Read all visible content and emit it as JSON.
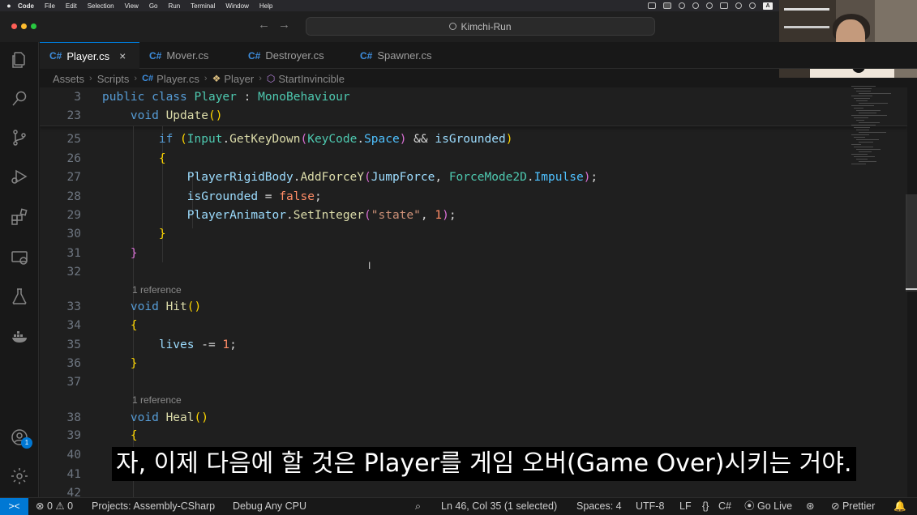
{
  "menubar": {
    "apple": "",
    "items": [
      "Code",
      "File",
      "Edit",
      "Selection",
      "View",
      "Go",
      "Run",
      "Terminal",
      "Window",
      "Help"
    ],
    "tray_letter": "A"
  },
  "titlebar": {
    "search_text": "Kimchi-Run",
    "back": "←",
    "forward": "→"
  },
  "tabs": [
    {
      "label": "Player.cs",
      "icon": "C#",
      "active": true,
      "close": "×"
    },
    {
      "label": "Mover.cs",
      "icon": "C#"
    },
    {
      "label": "Destroyer.cs",
      "icon": "C#"
    },
    {
      "label": "Spawner.cs",
      "icon": "C#"
    }
  ],
  "breadcrumb": [
    "Assets",
    "Scripts",
    "Player.cs",
    "Player",
    "StartInvincible"
  ],
  "editor": {
    "lines": [
      {
        "n": "3",
        "tokens": [
          [
            "k",
            "public "
          ],
          [
            "k",
            "class "
          ],
          [
            "c",
            "Player"
          ],
          [
            "p",
            " : "
          ],
          [
            "c",
            "MonoBehaviour"
          ]
        ]
      },
      {
        "n": "23",
        "tokens": [
          [
            "p",
            "    "
          ],
          [
            "k",
            "void "
          ],
          [
            "f",
            "Update"
          ],
          [
            "br",
            "()"
          ]
        ]
      },
      {
        "n": "25",
        "tokens": [
          [
            "p",
            "        "
          ],
          [
            "k",
            "if "
          ],
          [
            "br",
            "("
          ],
          [
            "c",
            "Input"
          ],
          [
            "p",
            "."
          ],
          [
            "f",
            "GetKeyDown"
          ],
          [
            "br2",
            "("
          ],
          [
            "c",
            "KeyCode"
          ],
          [
            "p",
            "."
          ],
          [
            "m",
            "Space"
          ],
          [
            "br2",
            ")"
          ],
          [
            "p",
            " && "
          ],
          [
            "v",
            "isGrounded"
          ],
          [
            "br",
            ")"
          ]
        ]
      },
      {
        "n": "26",
        "tokens": [
          [
            "p",
            "        "
          ],
          [
            "br",
            "{"
          ]
        ]
      },
      {
        "n": "27",
        "tokens": [
          [
            "p",
            "            "
          ],
          [
            "v",
            "PlayerRigidBody"
          ],
          [
            "p",
            "."
          ],
          [
            "f",
            "AddForceY"
          ],
          [
            "br2",
            "("
          ],
          [
            "v",
            "JumpForce"
          ],
          [
            "p",
            ", "
          ],
          [
            "c",
            "ForceMode2D"
          ],
          [
            "p",
            "."
          ],
          [
            "m",
            "Impulse"
          ],
          [
            "br2",
            ")"
          ],
          [
            "p",
            ";"
          ]
        ]
      },
      {
        "n": "28",
        "tokens": [
          [
            "p",
            "            "
          ],
          [
            "v",
            "isGrounded"
          ],
          [
            "p",
            " = "
          ],
          [
            "fl",
            "false"
          ],
          [
            "p",
            ";"
          ]
        ]
      },
      {
        "n": "29",
        "tokens": [
          [
            "p",
            "            "
          ],
          [
            "v",
            "PlayerAnimator"
          ],
          [
            "p",
            "."
          ],
          [
            "f",
            "SetInteger"
          ],
          [
            "br2",
            "("
          ],
          [
            "s",
            "\"state\""
          ],
          [
            "p",
            ", "
          ],
          [
            "fl",
            "1"
          ],
          [
            "br2",
            ")"
          ],
          [
            "p",
            ";"
          ]
        ]
      },
      {
        "n": "30",
        "tokens": [
          [
            "p",
            "        "
          ],
          [
            "br",
            "}"
          ]
        ]
      },
      {
        "n": "31",
        "tokens": [
          [
            "p",
            "    "
          ],
          [
            "br2",
            "}"
          ]
        ]
      },
      {
        "n": "32",
        "tokens": []
      },
      {
        "lens": "1 reference"
      },
      {
        "n": "33",
        "tokens": [
          [
            "p",
            "    "
          ],
          [
            "k",
            "void "
          ],
          [
            "f",
            "Hit"
          ],
          [
            "br",
            "()"
          ]
        ]
      },
      {
        "n": "34",
        "tokens": [
          [
            "p",
            "    "
          ],
          [
            "br",
            "{"
          ]
        ]
      },
      {
        "n": "35",
        "tokens": [
          [
            "p",
            "        "
          ],
          [
            "v",
            "lives"
          ],
          [
            "p",
            " -= "
          ],
          [
            "fl",
            "1"
          ],
          [
            "p",
            ";"
          ]
        ]
      },
      {
        "n": "36",
        "tokens": [
          [
            "p",
            "    "
          ],
          [
            "br",
            "}"
          ]
        ]
      },
      {
        "n": "37",
        "tokens": []
      },
      {
        "lens": "1 reference"
      },
      {
        "n": "38",
        "tokens": [
          [
            "p",
            "    "
          ],
          [
            "k",
            "void "
          ],
          [
            "f",
            "Heal"
          ],
          [
            "br",
            "()"
          ]
        ]
      },
      {
        "n": "39",
        "tokens": [
          [
            "p",
            "    "
          ],
          [
            "br",
            "{"
          ]
        ]
      },
      {
        "n": "40",
        "tokens": []
      },
      {
        "n": "41",
        "tokens": []
      },
      {
        "n": "42",
        "tokens": []
      }
    ]
  },
  "subtitle": "자, 이제 다음에 할 것은 Player를 게임 오버(Game Over)시키는 거야.",
  "account_badge": "1",
  "statusbar": {
    "remote": "><",
    "errors": "0",
    "warnings": "0",
    "projects": "Projects: Assembly-CSharp",
    "debug": "Debug Any CPU",
    "position": "Ln 46, Col 35 (1 selected)",
    "spaces": "Spaces: 4",
    "encoding": "UTF-8",
    "eol": "LF",
    "language": "C#",
    "golive": "Go Live",
    "prettier": "Prettier"
  },
  "colors": {
    "accent": "#0078d4",
    "editor_bg": "#1f1f1f",
    "keyword": "#569cd6",
    "type": "#4ec9b0",
    "function": "#dcdcaa"
  }
}
